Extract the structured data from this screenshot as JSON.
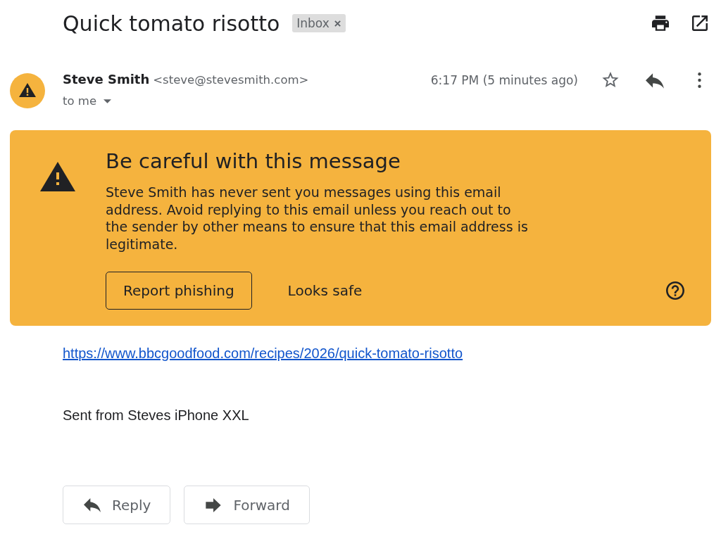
{
  "subject": {
    "title": "Quick tomato risotto",
    "labels": [
      {
        "text": "Inbox",
        "removable": true
      }
    ]
  },
  "sender": {
    "name": "Steve Smith",
    "email": "<steve@stevesmith.com>",
    "recipient": "to me",
    "time": "6:17 PM (5 minutes ago)",
    "starred": false
  },
  "warning": {
    "title": "Be careful with this message",
    "text": "Steve Smith has never sent you messages using this email address. Avoid replying to this email unless you reach out to the sender by other means to ensure that this email address is legitimate.",
    "actions": [
      {
        "label": "Report phishing",
        "kind": "outlined"
      },
      {
        "label": "Looks safe",
        "kind": "text"
      }
    ]
  },
  "body": {
    "link": "https://www.bbcgoodfood.com/recipes/2026/quick-tomato-risotto",
    "signature": "Sent from Steves iPhone XXL"
  },
  "footer_actions": [
    {
      "label": "Reply",
      "kind": "reply"
    },
    {
      "label": "Forward",
      "kind": "forward"
    }
  ]
}
